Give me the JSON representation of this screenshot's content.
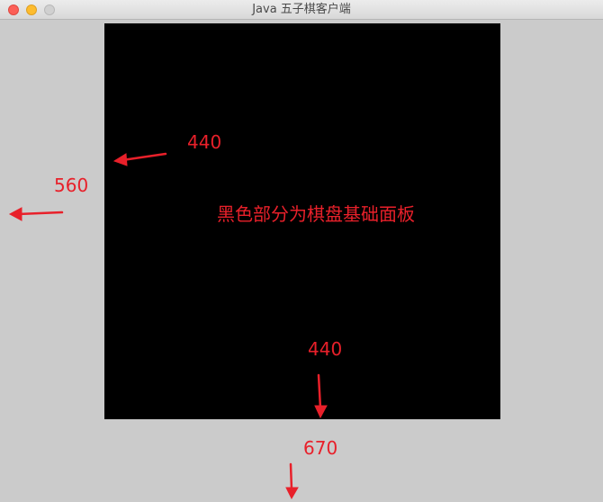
{
  "window": {
    "title": "Java 五子棋客户端"
  },
  "board": {
    "caption": "黑色部分为棋盘基础面板"
  },
  "annotations": {
    "board_height": "440",
    "window_height": "560",
    "board_width": "440",
    "window_width": "670",
    "color": "#e8202a"
  },
  "colors": {
    "board": "#000000",
    "window_bg": "#cbcbcb"
  }
}
